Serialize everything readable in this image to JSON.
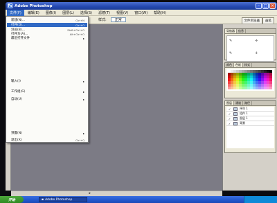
{
  "window": {
    "title": "Adobe Photoshop",
    "app_icon": "Ps"
  },
  "menubar": {
    "items": [
      "文件(F)",
      "编辑(E)",
      "图像(I)",
      "图层(L)",
      "选择(S)",
      "滤镜(T)",
      "视图(V)",
      "窗口(W)",
      "帮助(H)"
    ]
  },
  "options": {
    "style_label": "样式:",
    "style_value": "正常"
  },
  "dock_tabs": [
    "文件浏览器",
    "画笔"
  ],
  "file_menu": {
    "items": [
      {
        "label": "新建(N)...",
        "shortcut": "Ctrl+N"
      },
      {
        "label": "打开(O)...",
        "shortcut": "Ctrl+O",
        "highlighted": true
      },
      {
        "label": "浏览(B)...",
        "shortcut": "Shift+Ctrl+O"
      },
      {
        "label": "打开为(A)...",
        "shortcut": "Alt+Ctrl+O"
      },
      {
        "label": "最近打开文件",
        "submenu": true
      },
      {
        "label": "输入(I)",
        "submenu": true
      },
      {
        "label": "工作组(G)",
        "submenu": true
      },
      {
        "label": "自动(U)",
        "submenu": true
      },
      {
        "label": "预置(N)",
        "submenu": true
      },
      {
        "label": "退出(X)",
        "shortcut": "Ctrl+Q"
      }
    ]
  },
  "panels": {
    "navigator_tabs": [
      "导航器",
      "信息"
    ],
    "color_tabs": [
      "颜色",
      "色板",
      "样式"
    ],
    "layers_tabs": [
      "图层",
      "通道",
      "路径"
    ],
    "layers": [
      "序列 1",
      "组件 1",
      "图层 1",
      "背景"
    ]
  },
  "taskbar": {
    "start": "开始",
    "task": "Adobe Photoshop",
    "time": ""
  },
  "colors": {
    "workspace": "#7c7b85",
    "highlight": "#316ac5",
    "titlebar": "#2448b0"
  }
}
